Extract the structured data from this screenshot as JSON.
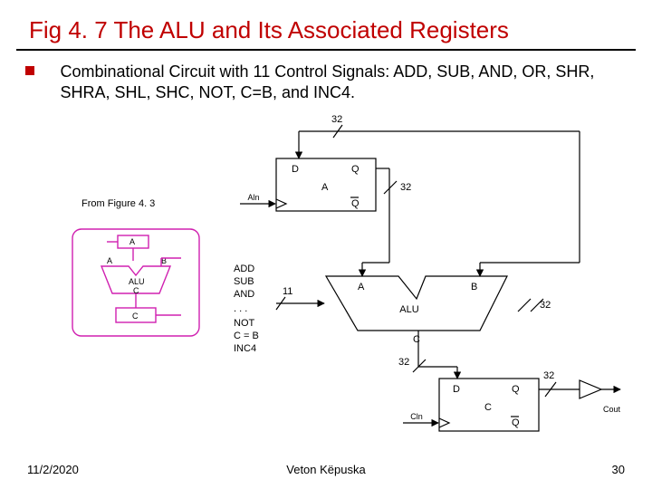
{
  "title": "Fig 4. 7  The ALU and Its Associated Registers",
  "bullet": "Combinational Circuit with 11 Control Signals: ADD, SUB, AND, OR, SHR, SHRA, SHL, SHC, NOT, C=B, and INC4.",
  "footer": {
    "date": "11/2/2020",
    "author": "Veton Këpuska",
    "page": "30"
  },
  "bus_widths": {
    "top": "32",
    "a_right": "32",
    "c_bottom_left": "32",
    "c_bottom_right": "32",
    "b_right": "32",
    "ctrl": "11"
  },
  "regA": {
    "D": "D",
    "Q": "Q",
    "name": "A",
    "Qbar": "Q",
    "clk": "Aln"
  },
  "regC": {
    "D": "D",
    "Q": "Q",
    "name": "C",
    "Qbar": "Q",
    "clk": "Cln",
    "out": "Cout"
  },
  "alu": {
    "A": "A",
    "B": "B",
    "C": "C",
    "name": "ALU"
  },
  "ctrl_signals": [
    "ADD",
    "SUB",
    "AND",
    "NOT",
    "C = B",
    "INC4"
  ],
  "ellipsis": ". . .",
  "inset": {
    "caption": "From Figure 4. 3",
    "top": "A",
    "A": "A",
    "B": "B",
    "ALU": "ALU",
    "Cmid": "C",
    "Cbot": "C"
  }
}
